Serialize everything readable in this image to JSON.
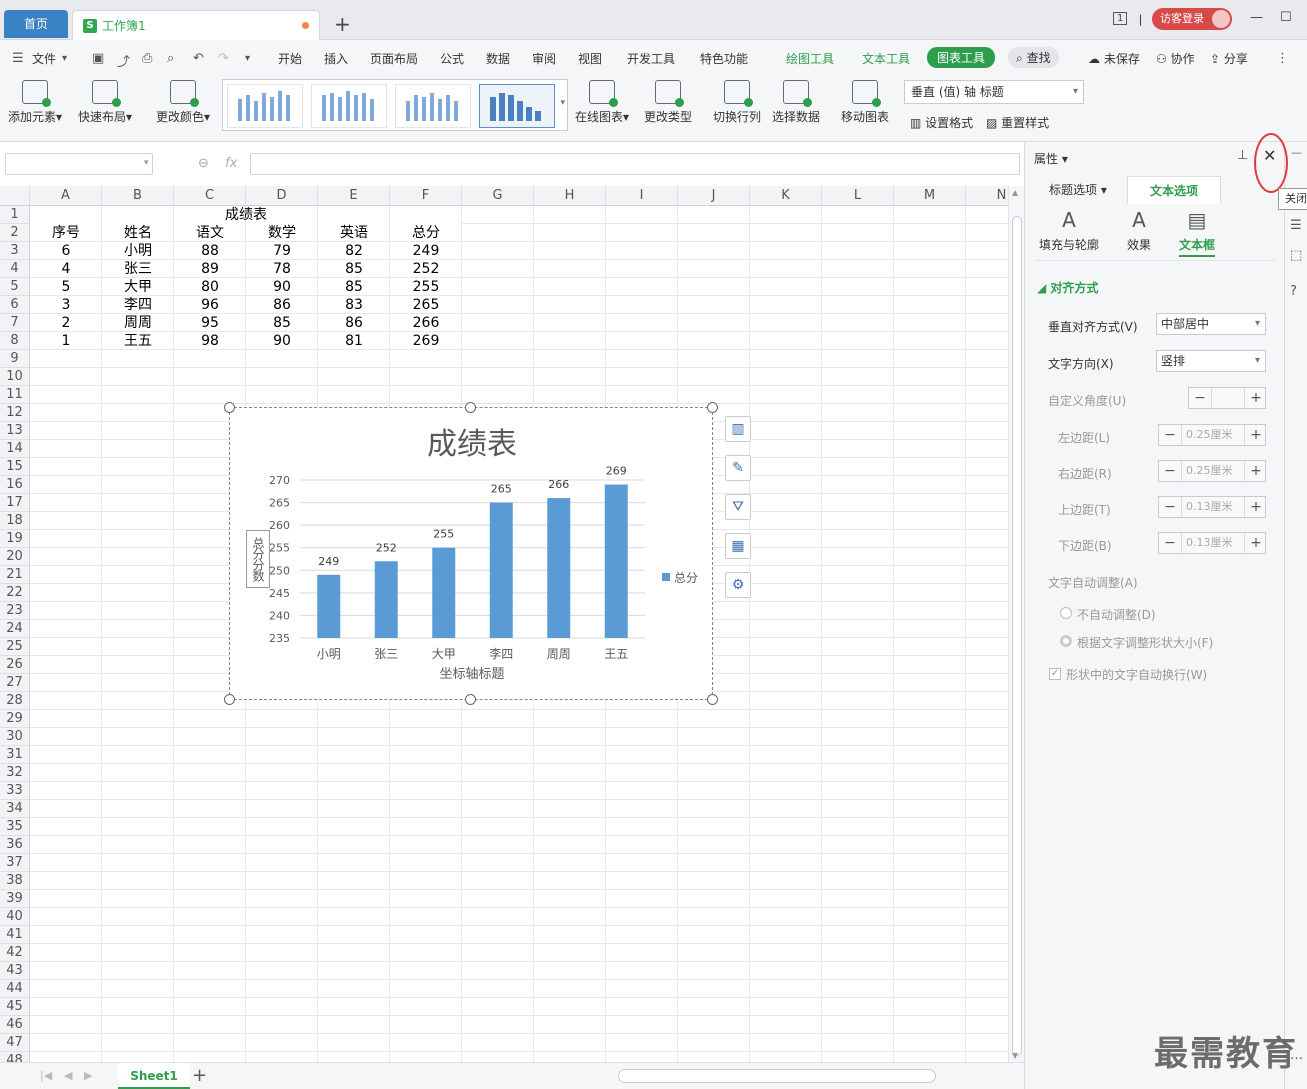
{
  "tabs": {
    "home": "首页",
    "doc": "工作簿1"
  },
  "topright": {
    "login": "访客登录",
    "page_indicator": "1"
  },
  "menu": {
    "file": "文件",
    "items": [
      "开始",
      "插入",
      "页面布局",
      "公式",
      "数据",
      "审阅",
      "视图",
      "开发工具",
      "特色功能"
    ],
    "tool_tabs": [
      "绘图工具",
      "文本工具"
    ],
    "active_tool": "图表工具",
    "find": "查找",
    "right": [
      "未保存",
      "协作",
      "分享"
    ]
  },
  "ribbon": {
    "add_element": "添加元素",
    "quick_layout": "快速布局",
    "change_color": "更改颜色",
    "online_chart": "在线图表",
    "change_type": "更改类型",
    "switch_rowcol": "切换行列",
    "select_data": "选择数据",
    "move_chart": "移动图表",
    "element_select": "垂直 (值) 轴 标题",
    "set_format": "设置格式",
    "reset_style": "重置样式"
  },
  "sheet": {
    "columns": [
      "A",
      "B",
      "C",
      "D",
      "E",
      "F",
      "G",
      "H",
      "I",
      "J",
      "K",
      "L",
      "M",
      "N"
    ],
    "title": "成绩表",
    "headers": [
      "序号",
      "姓名",
      "语文",
      "数学",
      "英语",
      "总分"
    ],
    "rows": [
      [
        "6",
        "小明",
        "88",
        "79",
        "82",
        "249"
      ],
      [
        "4",
        "张三",
        "89",
        "78",
        "85",
        "252"
      ],
      [
        "5",
        "大甲",
        "80",
        "90",
        "85",
        "255"
      ],
      [
        "3",
        "李四",
        "96",
        "86",
        "83",
        "265"
      ],
      [
        "2",
        "周周",
        "95",
        "85",
        "86",
        "266"
      ],
      [
        "1",
        "王五",
        "98",
        "90",
        "81",
        "269"
      ]
    ],
    "tab": "Sheet1"
  },
  "chart_data": {
    "type": "bar",
    "title": "成绩表",
    "categories": [
      "小明",
      "张三",
      "大甲",
      "李四",
      "周周",
      "王五"
    ],
    "series": [
      {
        "name": "总分",
        "values": [
          249,
          252,
          255,
          265,
          266,
          269
        ],
        "color": "#5b9bd5"
      }
    ],
    "xlabel": "坐标轴标题",
    "ylabel": "总分分数",
    "ylim": [
      235,
      270
    ],
    "yticks": [
      235,
      240,
      245,
      250,
      255,
      260,
      265,
      270
    ],
    "legend": "right",
    "grid": true
  },
  "panel": {
    "title": "属性",
    "tabs": [
      "标题选项",
      "文本选项"
    ],
    "subtabs": [
      "填充与轮廓",
      "效果",
      "文本框"
    ],
    "section": "对齐方式",
    "vertical_align_label": "垂直对齐方式(V)",
    "vertical_align_value": "中部居中",
    "text_dir_label": "文字方向(X)",
    "text_dir_value": "竖排",
    "custom_angle_label": "自定义角度(U)",
    "left_margin_label": "左边距(L)",
    "left_margin_value": "0.25厘米",
    "right_margin_label": "右边距(R)",
    "right_margin_value": "0.25厘米",
    "top_margin_label": "上边距(T)",
    "top_margin_value": "0.13厘米",
    "bottom_margin_label": "下边距(B)",
    "bottom_margin_value": "0.13厘米",
    "autofit_label": "文字自动调整(A)",
    "no_autofit": "不自动调整(D)",
    "resize_shape": "根据文字调整形状大小(F)",
    "wrap_text": "形状中的文字自动换行(W)",
    "tooltip": "关闭"
  },
  "watermark": "最需教育",
  "colors": {
    "accent": "#2e9e4e",
    "bar": "#5b9bd5",
    "highlight": "#e03a3a"
  }
}
